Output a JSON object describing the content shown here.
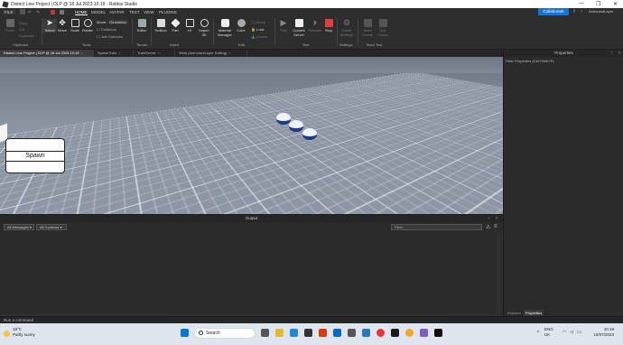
{
  "window": {
    "title": "District Line Project | DLP @ 18 Jul 2023 10:19 - Roblox Studio",
    "minimize": "—",
    "maximize": "❐",
    "close": "✕"
  },
  "menu": {
    "file": "FILE",
    "home": "HOME",
    "model": "MODEL",
    "avatar": "AVATAR",
    "test": "TEST",
    "view": "VIEW",
    "plugins": "PLUGINS",
    "collaborate": "Collaborate",
    "user": "AstronautLayer"
  },
  "ribbon": {
    "paste": "Paste",
    "copy": "Copy",
    "cut": "Cut",
    "duplicate": "Duplicate",
    "select": "Select",
    "move": "Move",
    "scale": "Scale",
    "rotate": "Rotate",
    "mode_label": "Mode:",
    "mode_value": "Geometric",
    "collisions": "Collisions",
    "join_surfaces": "Join Surfaces",
    "editor": "Editor",
    "toolbox": "Toolbox",
    "part": "Part",
    "ui": "UI",
    "import3d": "Import 3D",
    "material_manager": "Material Manager",
    "color": "Color",
    "group": "Group",
    "lock": "Lock",
    "anchor": "Anchor",
    "play": "Play",
    "current_server": "Current Server",
    "resume": "Resume",
    "stop": "Stop",
    "game_settings": "Game Settings",
    "team_create": "Team Create",
    "exit_game": "Exit Game",
    "groups": {
      "clipboard": "Clipboard",
      "tools": "Tools",
      "terrain": "Terrain",
      "insert": "Insert",
      "edit": "Edit",
      "test": "Test",
      "settings": "Settings",
      "team_test": "Team Test"
    }
  },
  "tabs": [
    {
      "label": "District Line Project | DLP @ 18 Jul 2023 10:19"
    },
    {
      "label": "SpawnTrain"
    },
    {
      "label": "TrainServer"
    },
    {
      "label": "Weld (AstronautLayer Editing)"
    }
  ],
  "tab_close": "×",
  "viewport": {
    "spawn_label": "Spawn"
  },
  "output": {
    "title": "Output",
    "messages_filter": "All Messages",
    "contexts_filter": "All Contexts",
    "filter_placeholder": "Filter..."
  },
  "command_bar": {
    "placeholder": "Run a command"
  },
  "properties": {
    "title": "Properties",
    "filter_placeholder": "Filter Properties (Ctrl+Shift+P)",
    "tab_explorer": "Explorer",
    "tab_properties": "Properties"
  },
  "taskbar": {
    "temp": "18°C",
    "weather": "Partly sunny",
    "search_placeholder": "Search",
    "lang": "ENG",
    "region": "UK",
    "time": "10:19",
    "date": "18/07/2023"
  }
}
